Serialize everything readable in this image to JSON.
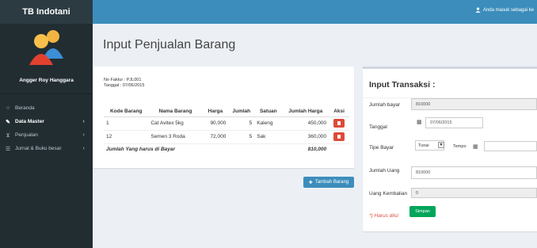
{
  "app": {
    "brand": "TB Indotani"
  },
  "header": {
    "user_note": "Anda masuk sebagai ke"
  },
  "sidebar": {
    "user_name": "Angger Roy Hanggara",
    "items": [
      {
        "label": "Beranda",
        "icon": "circle-o-icon",
        "active": false
      },
      {
        "label": "Data Master",
        "icon": "edit-icon",
        "active": true
      },
      {
        "label": "Penjualan",
        "icon": "cart-icon",
        "active": false
      },
      {
        "label": "Jurnal & Buku besar",
        "icon": "book-icon",
        "active": false
      }
    ]
  },
  "page": {
    "title": "Input Penjualan Barang"
  },
  "invoice": {
    "faktur_line": "No Faktur  : PJL001",
    "tanggal_line": "Tanggal    : 07/06/2015"
  },
  "table": {
    "headers": [
      "Kode Barang",
      "Nama Barang",
      "Harga",
      "Jumlah",
      "Satuan",
      "Jumlah Harga",
      "Aksi"
    ],
    "rows": [
      {
        "kode": "1",
        "nama": "Cat Avitex 5kg",
        "harga": "90,000",
        "jumlah": "5",
        "satuan": "Kaleng",
        "jumlah_harga": "450,000"
      },
      {
        "kode": "12",
        "nama": "Semen 3 Roda",
        "harga": "72,000",
        "jumlah": "5",
        "satuan": "Sak",
        "jumlah_harga": "360,000"
      }
    ],
    "total_label": "Jumlah Yang harus di Bayar",
    "total_value": "810,000"
  },
  "buttons": {
    "add": "Tambah Barang",
    "save": "Simpan"
  },
  "transaction": {
    "title": "Input Transaksi :",
    "jumlah_bayar_label": "Jumlah bayar",
    "jumlah_bayar_value": "810000",
    "tanggal_label": "Tanggal",
    "tanggal_value": "07/06/2015",
    "tipe_bayar_label": "Tipe Bayar",
    "tipe_bayar_value": "Tunai",
    "tempo_label": "Tempo",
    "jumlah_uang_label": "Jumlah Uang",
    "jumlah_uang_value": "810000",
    "kembalian_label": "Uang Kembalian",
    "kembalian_value": "0",
    "required_note": "*) Harus diisi"
  },
  "colors": {
    "topbar": "#3c8dbc",
    "sidebar": "#222d32",
    "danger": "#dd4b39",
    "success": "#00a65a"
  }
}
